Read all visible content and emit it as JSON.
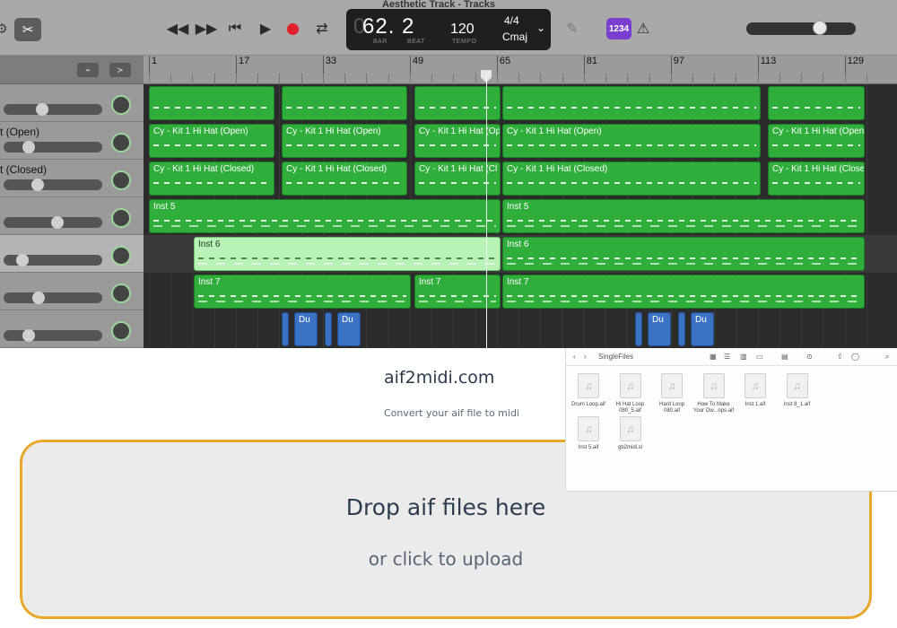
{
  "daw": {
    "window_title": "Aesthetic Track - Tracks",
    "position_display": "62. 2",
    "position_dim": "0",
    "position_labels": [
      "BAR",
      "BEAT"
    ],
    "tempo": "120",
    "tempo_label": "TEMPO",
    "time_signature": "4/4",
    "key": "Cmaj",
    "count_in": "1234",
    "icons": {
      "gear": "gear-icon",
      "scissors": "scissors-icon",
      "rewind": "rewind-icon",
      "fast_forward": "fast-forward-icon",
      "go_to_start": "go-to-start-icon",
      "play": "play-icon",
      "record": "record-icon",
      "cycle": "cycle-icon",
      "tuner": "tuner-icon",
      "metronome": "metronome-icon"
    },
    "colors": {
      "region": "#2fae3b",
      "region_selected": "#b9f2b6",
      "drummer": "#3b72c4",
      "record": "#e0202a",
      "count_in": "#7a3fd1"
    },
    "ruler_marks": [
      "1",
      "17",
      "33",
      "49",
      "65",
      "81",
      "97",
      "113",
      "129"
    ],
    "tracks": [
      {
        "name": "",
        "vol": 0.38
      },
      {
        "name": "t (Open)",
        "vol": 0.22
      },
      {
        "name": "t (Closed)",
        "vol": 0.32
      },
      {
        "name": "",
        "vol": 0.55
      },
      {
        "name": "",
        "vol": 0.15,
        "selected": true
      },
      {
        "name": "",
        "vol": 0.33
      },
      {
        "name": "",
        "vol": 0.22
      }
    ],
    "region_labels": {
      "hh_open": "Cy - Kit 1 Hi Hat (Open)",
      "hh_open_short": "Cy - Kit 1 Hi Hat (Op",
      "hh_closed": "Cy - Kit 1 Hi Hat (Closed)",
      "hh_closed_short": "Cy - Kit 1 Hi Hat (Cl",
      "hh_closed_end": "Cy - Kit 1 Hi Hat (Close",
      "inst5": "Inst 5",
      "inst6": "Inst 6",
      "inst7": "Inst 7",
      "du": "Du",
      "dun": "Dun"
    }
  },
  "web": {
    "site_name": "aif2midi.com",
    "tagline": "Convert your aif file to midi",
    "drop_title": "Drop aif files here",
    "drop_sub": "or click to upload",
    "accent_color": "#e8a92b"
  },
  "finder": {
    "folder": "SingleFiles",
    "files": [
      {
        "name": "Drum Loop.aif"
      },
      {
        "name": "Hi Hat Loop 080_5.aif"
      },
      {
        "name": "Hard Loop 080.aif"
      },
      {
        "name": "How To Make Your Ow...ops.aif"
      },
      {
        "name": "Inst 1.aif"
      },
      {
        "name": "Inst 8_1.aif"
      },
      {
        "name": "Inst 5.aif"
      },
      {
        "name": "gb2midi.sl"
      }
    ]
  }
}
